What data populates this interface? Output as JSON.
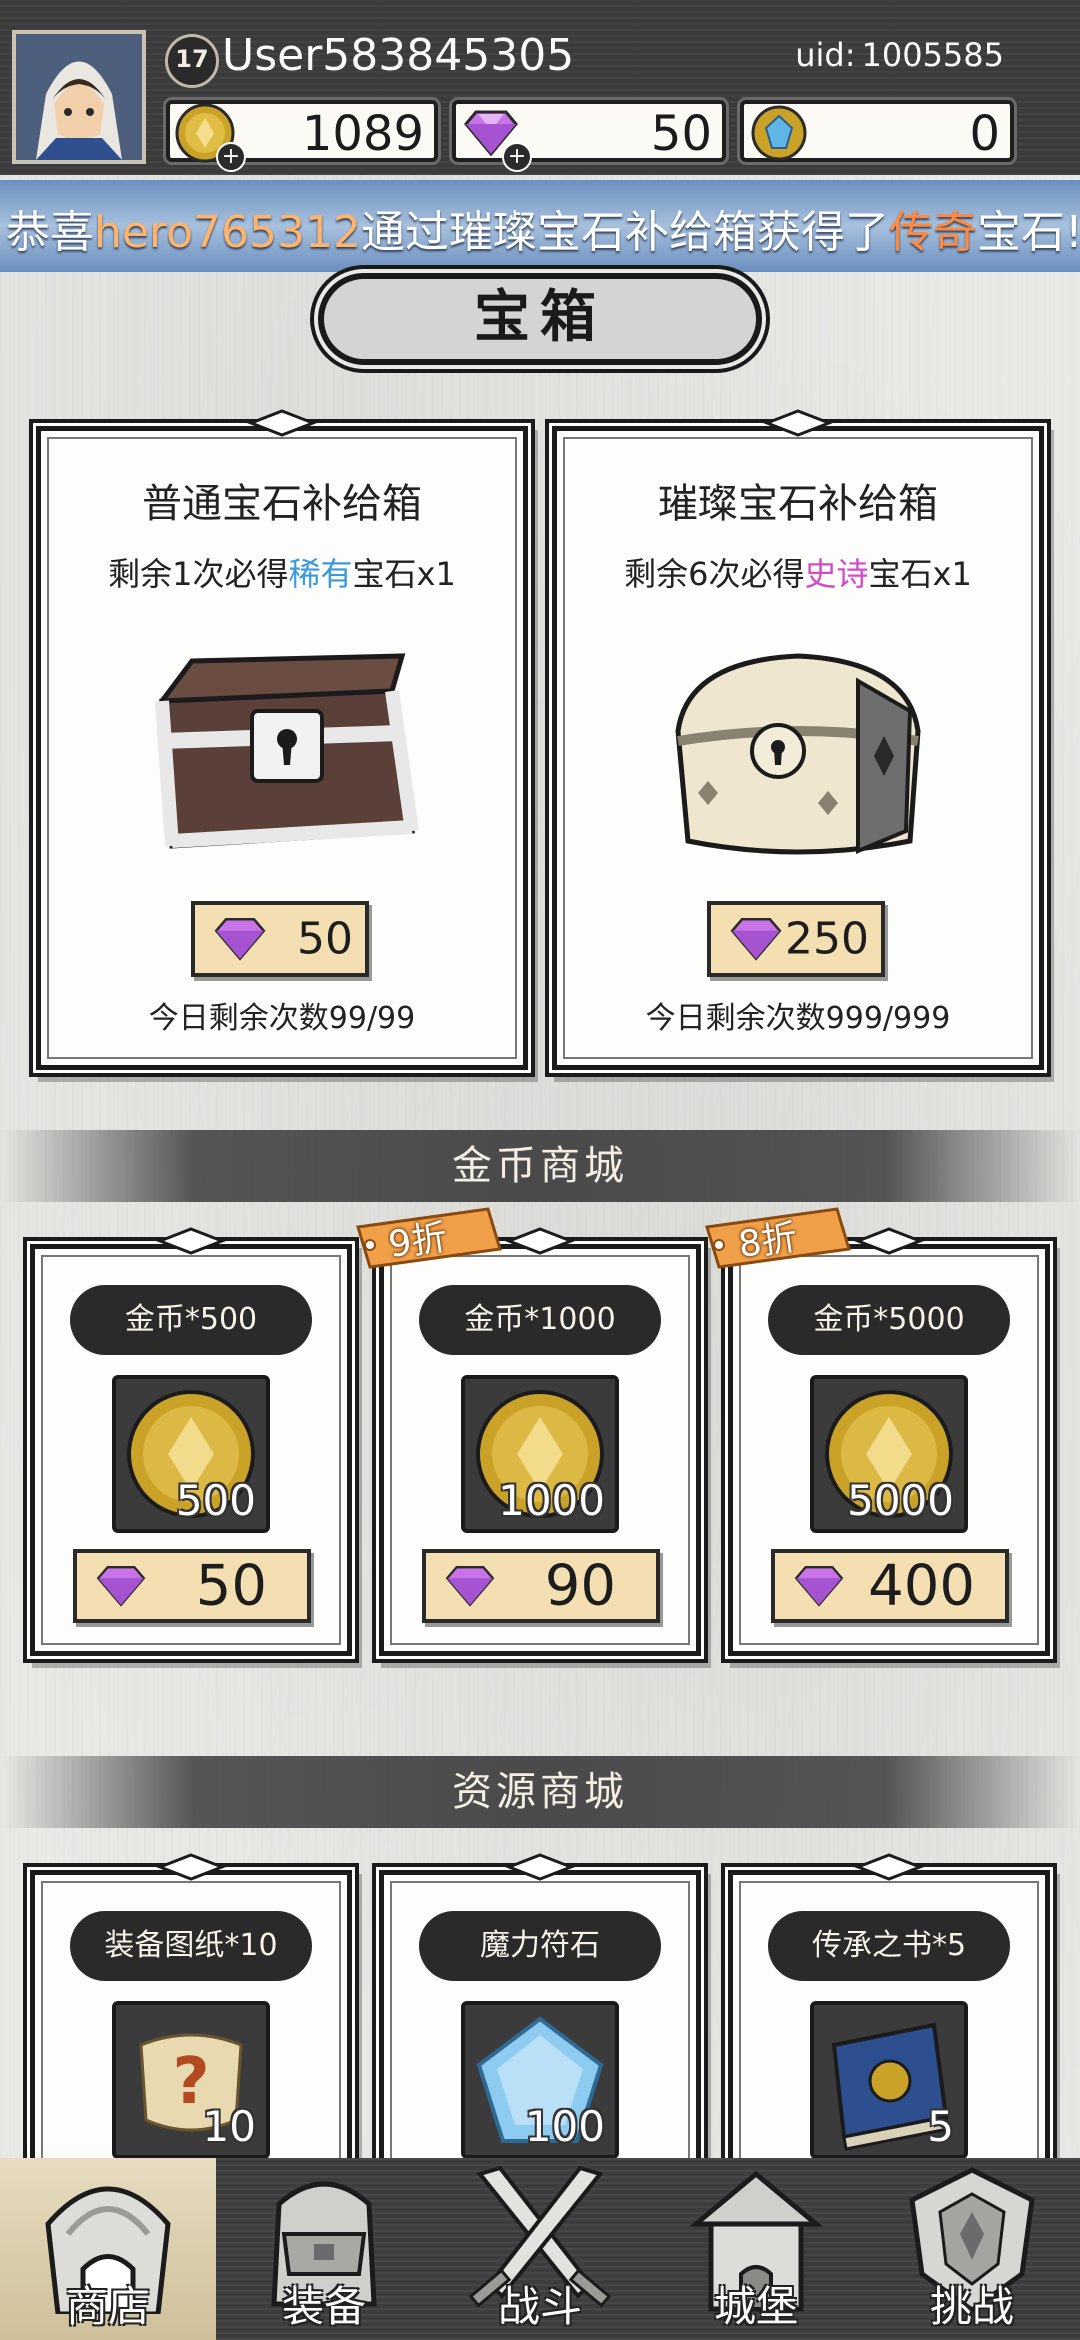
{
  "player": {
    "level": "17",
    "username": "User583845305",
    "uid_prefix": "uid:",
    "uid": "1005585"
  },
  "resources": [
    {
      "icon": "gold-coin-icon",
      "value": "1089",
      "has_plus": true
    },
    {
      "icon": "purple-gem-icon",
      "value": "50",
      "has_plus": true
    },
    {
      "icon": "blue-crystal-icon",
      "value": "0",
      "has_plus": false
    }
  ],
  "announcement": {
    "prefix": "恭喜",
    "player": "hero765312",
    "middle": "通过璀璨宝石补给箱获得了",
    "rarity": "传奇",
    "suffix": "宝石!"
  },
  "chest_section": {
    "title": "宝箱"
  },
  "chests": [
    {
      "name": "普通宝石补给箱",
      "guarantee_pre": "剩余1次必得",
      "guarantee_rarity": "稀有",
      "guarantee_post": "宝石x1",
      "price": "50",
      "remaining": "今日剩余次数99/99"
    },
    {
      "name": "璀璨宝石补给箱",
      "guarantee_pre": "剩余6次必得",
      "guarantee_rarity": "史诗",
      "guarantee_post": "宝石x1",
      "price": "250",
      "remaining": "今日剩余次数999/999"
    }
  ],
  "gold_shop": {
    "title": "金币商城",
    "items": [
      {
        "label": "金币*500",
        "qty": "500",
        "price": "50",
        "discount": ""
      },
      {
        "label": "金币*1000",
        "qty": "1000",
        "price": "90",
        "discount": "9折"
      },
      {
        "label": "金币*5000",
        "qty": "5000",
        "price": "400",
        "discount": "8折"
      }
    ]
  },
  "resource_shop": {
    "title": "资源商城",
    "items": [
      {
        "label": "装备图纸*10",
        "qty": "10",
        "icon": "scroll-icon"
      },
      {
        "label": "魔力符石",
        "qty": "100",
        "icon": "rune-crystal-icon"
      },
      {
        "label": "传承之书*5",
        "qty": "5",
        "icon": "book-icon"
      }
    ]
  },
  "nav": [
    {
      "label": "商店",
      "icon": "shop-icon",
      "active": true
    },
    {
      "label": "装备",
      "icon": "backpack-icon",
      "active": false
    },
    {
      "label": "战斗",
      "icon": "crossed-swords-icon",
      "active": false
    },
    {
      "label": "城堡",
      "icon": "castle-icon",
      "active": false
    },
    {
      "label": "挑战",
      "icon": "crest-icon",
      "active": false
    }
  ],
  "colors": {
    "rare": "#3d9ad8",
    "epic": "#d04cc8",
    "legendary": "#ff8a3d",
    "price_button": "#f3dfb1"
  }
}
